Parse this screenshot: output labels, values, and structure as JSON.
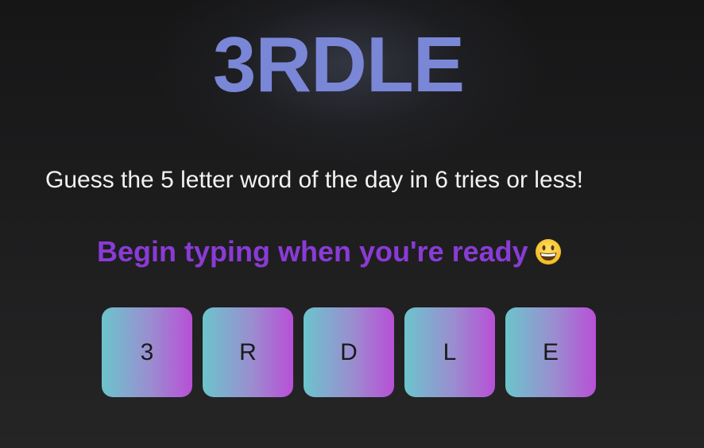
{
  "app": {
    "title": "3RDLE"
  },
  "instructions": "Guess the 5 letter word of the day in 6 tries or less!",
  "prompt": {
    "text": "Begin typing when you're ready",
    "emoji": "grinning-face-emoji"
  },
  "tiles": [
    "3",
    "R",
    "D",
    "L",
    "E"
  ],
  "colors": {
    "background": "#1c1c1d",
    "logo": "#7a86d6",
    "prompt": "#8a3bd6",
    "tile_gradient_start": "#6cc4cc",
    "tile_gradient_end": "#b84fd6"
  }
}
